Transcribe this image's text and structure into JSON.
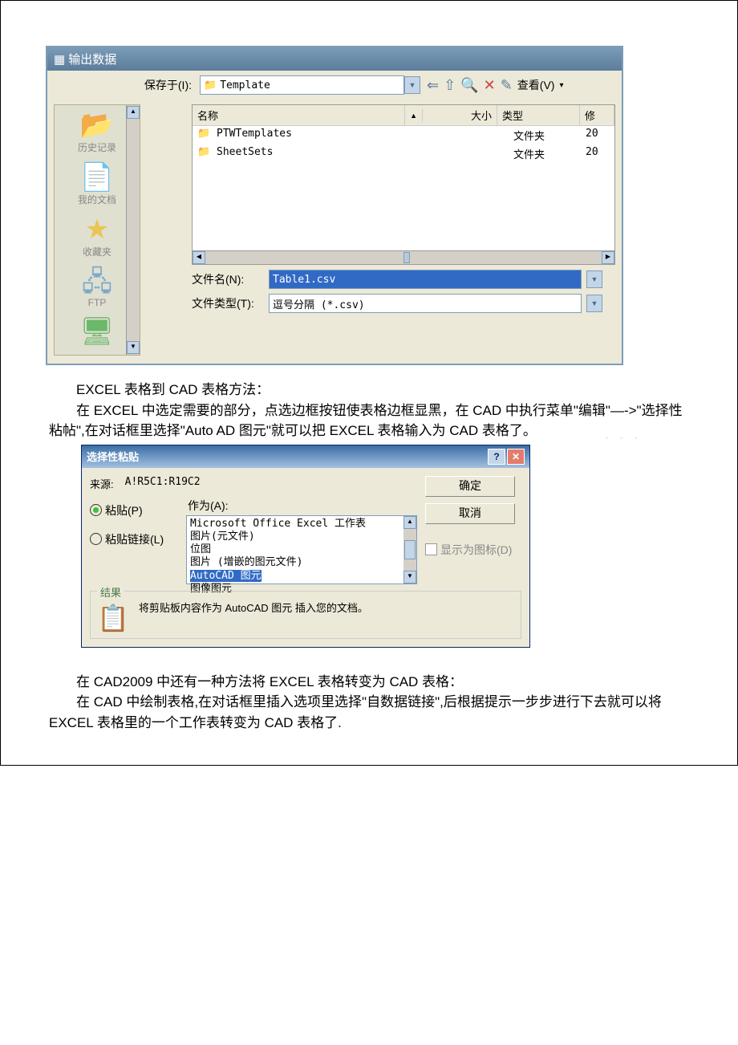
{
  "exportDialog": {
    "title": "输出数据",
    "saveInLabel": "保存于(I):",
    "saveInValue": "Template",
    "viewLabel": "查看(V)",
    "columns": {
      "name": "名称",
      "size": "大小",
      "type": "类型",
      "mod": "修"
    },
    "rows": [
      {
        "name": "PTWTemplates",
        "type": "文件夹",
        "mod": "20"
      },
      {
        "name": "SheetSets",
        "type": "文件夹",
        "mod": "20"
      }
    ],
    "sidebar": {
      "history": "历史记录",
      "mydocs": "我的文档",
      "fav": "收藏夹",
      "ftp": "FTP"
    },
    "fileNameLabel": "文件名(N):",
    "fileNameValue": "Table1.csv",
    "fileTypeLabel": "文件类型(T):",
    "fileTypeValue": "逗号分隔 (*.csv)"
  },
  "text": {
    "p1": "EXCEL 表格到 CAD 表格方法：",
    "p2": "在 EXCEL 中选定需要的部分，点选边框按钮使表格边框显黑，在 CAD 中执行菜单\"编辑\"—->\"选择性粘帖\",在对话框里选择\"Auto AD 图元\"就可以把 EXCEL 表格输入为 CAD 表格了。",
    "p3": "在 CAD2009 中还有一种方法将 EXCEL 表格转变为 CAD 表格：",
    "p4": "在 CAD 中绘制表格,在对话框里插入选项里选择\"自数据链接\",后根据提示一步步进行下去就可以将 EXCEL 表格里的一个工作表转变为 CAD 表格了."
  },
  "pasteDialog": {
    "title": "选择性粘贴",
    "sourceLabel": "来源:",
    "sourceValue": "A!R5C1:R19C2",
    "asLabel": "作为(A):",
    "ok": "确定",
    "cancel": "取消",
    "paste": "粘贴(P)",
    "pasteLink": "粘贴链接(L)",
    "options": {
      "o1": "Microsoft Office Excel 工作表",
      "o2": "图片(元文件)",
      "o3": "位图",
      "o4": "图片 (增嵌的图元文件)",
      "o5": "AutoCAD 图元",
      "o6": "图像图元"
    },
    "showIcon": "显示为图标(D)",
    "resultLabel": "结果",
    "resultText": "将剪贴板内容作为 AutoCAD 图元 插入您的文档。"
  }
}
